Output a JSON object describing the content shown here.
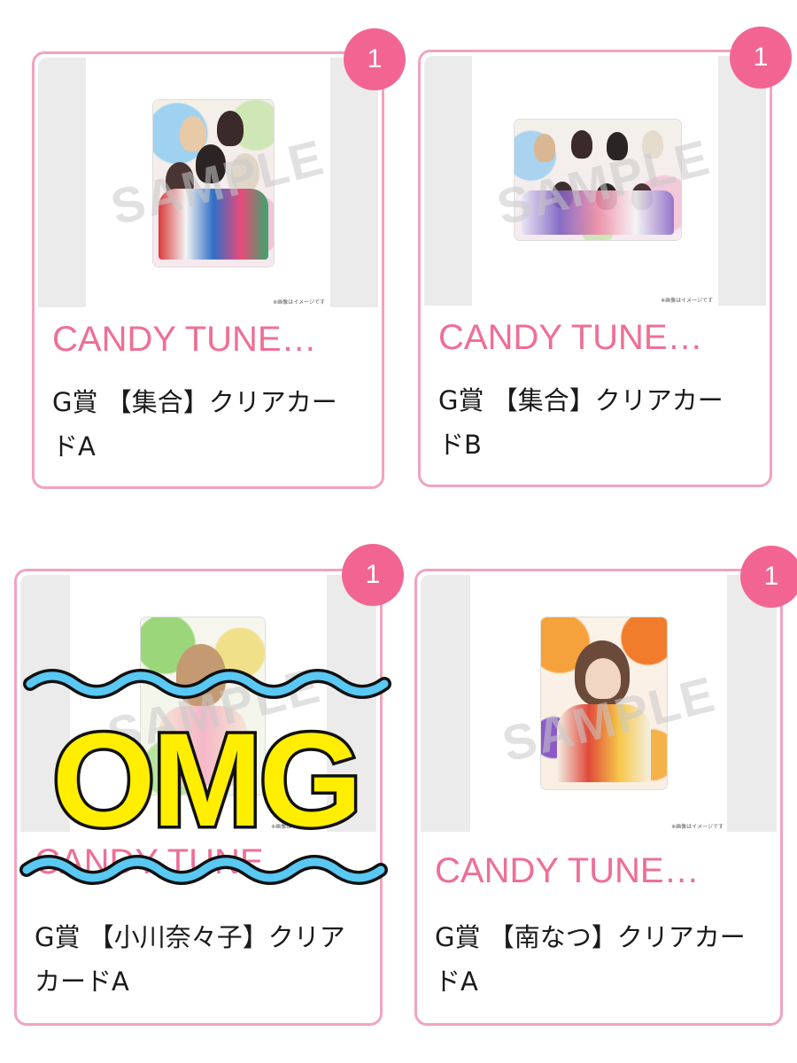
{
  "items": [
    {
      "count": "1",
      "title": "CANDY TUNE…",
      "name": "G賞 【集合】クリアカードA",
      "watermark": "SAMPLE",
      "image_note": "※画像はイメージです"
    },
    {
      "count": "1",
      "title": "CANDY TUNE…",
      "name": "G賞 【集合】クリアカードB",
      "watermark": "SAMPLE",
      "image_note": "※画像はイメージです"
    },
    {
      "count": "1",
      "title": "CANDY TUNE",
      "name": "G賞 【小川奈々子】クリアカードA",
      "watermark": "SAMPLE",
      "image_note": "※画像はイメージです"
    },
    {
      "count": "1",
      "title": "CANDY TUNE…",
      "name": "G賞 【南なつ】クリアカードA",
      "watermark": "SAMPLE",
      "image_note": "※画像はイメージです"
    }
  ],
  "overlay": {
    "text": "OMG"
  },
  "colors": {
    "accent_pink": "#ee6f96",
    "badge_pink": "#f26593",
    "card_border": "#f2a3bd",
    "overlay_fill": "#ffee00",
    "wave_blue": "#59c8f2"
  }
}
